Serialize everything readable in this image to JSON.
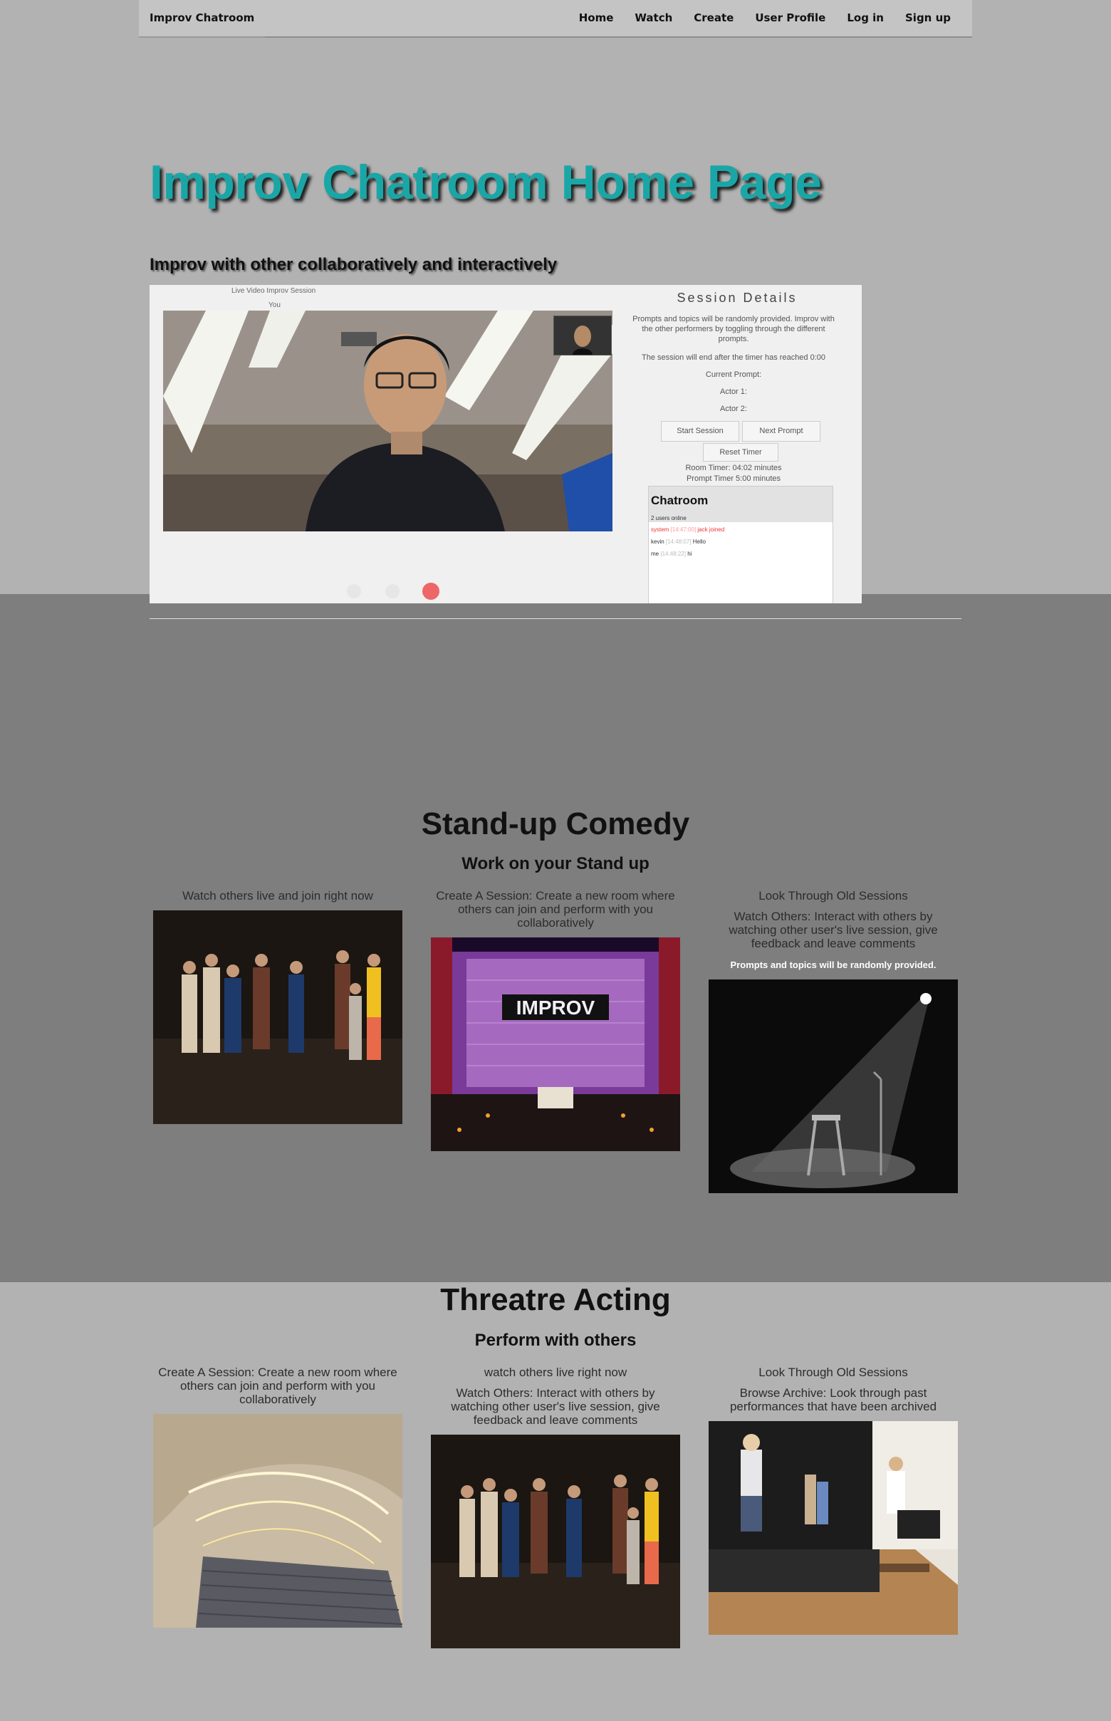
{
  "nav": {
    "brand": "Improv Chatroom",
    "links": [
      "Home",
      "Watch",
      "Create",
      "User Profile",
      "Log in",
      "Sign up"
    ]
  },
  "hero": {
    "title": "Improv Chatroom Home Page",
    "subtitle": "Improv with other collaboratively and interactively"
  },
  "demo": {
    "caption_top": "Live Video Improv Session",
    "caption_you": "You",
    "details_title": "Session Details",
    "details_desc": "Prompts and topics will be randomly provided. Improv with the other performers by toggling through the different prompts.",
    "details_end": "The session will end after the timer has reached 0:00",
    "current_prompt": "Current Prompt:",
    "actor1": "Actor 1:",
    "actor2": "Actor 2:",
    "start_btn": "Start Session",
    "next_btn": "Next Prompt",
    "reset_btn": "Reset Timer",
    "room_timer": "Room Timer: 04:02 minutes",
    "prompt_timer": "Prompt Timer 5:00 minutes",
    "chat_title": "Chatroom",
    "chat_count": "2 users online",
    "chat_lines": [
      {
        "user": "system",
        "time": "[14:47:00]",
        "msg": "jack joined"
      },
      {
        "user": "kevin",
        "time": "[14:48:07]",
        "msg": "Hello"
      },
      {
        "user": "me",
        "time": "[14:48:22]",
        "msg": "hi"
      }
    ]
  },
  "standup": {
    "title": "Stand-up Comedy",
    "subtitle": "Work on your Stand up",
    "col1": "Watch others live and join right now",
    "col2": "Create A Session: Create a new room where others can join and perform with you collaboratively",
    "col3_a": "Look Through Old Sessions",
    "col3_b": "Watch Others: Interact with others by watching other user's live session, give feedback and leave comments",
    "col3_note": "Prompts and topics will be randomly provided."
  },
  "theatre": {
    "title": "Threatre Acting",
    "subtitle": "Perform with others",
    "col1": "Create A Session: Create a new room where others can join and perform with you collaboratively",
    "col2_a": "watch others live right now",
    "col2_b": "Watch Others: Interact with others by watching other user's live session, give feedback and leave comments",
    "col3_a": "Look Through Old Sessions",
    "col3_b": "Browse Archive: Look through past performances that have been archived"
  },
  "colors": {
    "accent": "#1aa6a6",
    "band": "#7e7e7e",
    "page": "#b2b2b2"
  }
}
